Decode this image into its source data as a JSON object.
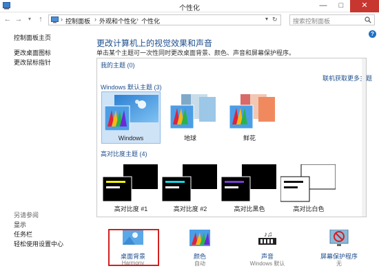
{
  "window": {
    "title": "个性化"
  },
  "window_buttons": {
    "minimize": "—",
    "maximize": "□",
    "close": "✕"
  },
  "navbar": {
    "breadcrumbs": [
      "控制面板",
      "外观和个性化",
      "个性化"
    ],
    "search_placeholder": "搜索控制面板"
  },
  "sidebar": {
    "links": [
      "控制面板主页",
      "更改桌面图标",
      "更改鼠标指针"
    ],
    "see_also_title": "另请参阅",
    "see_also": [
      "显示",
      "任务栏",
      "轻松使用设置中心"
    ]
  },
  "main": {
    "headline": "更改计算机上的视觉效果和声音",
    "subline": "单击某个主题可一次性同时更改桌面背景、颜色、声音和屏幕保护程序。",
    "my_themes_label": "我的主题 (0)",
    "get_more_link": "联机获取更多主题",
    "default_themes_label": "Windows 默认主题 (3)",
    "themes": [
      {
        "name": "Windows",
        "selected": true
      },
      {
        "name": "地球",
        "selected": false
      },
      {
        "name": "鲜花",
        "selected": false
      }
    ],
    "high_contrast_label": "高对比度主题 (4)",
    "high_contrast_themes": [
      {
        "name": "高对比度 #1",
        "bar": "#f5f500"
      },
      {
        "name": "高对比度 #2",
        "bar": "#12d8e8"
      },
      {
        "name": "高对比黑色",
        "bar": "#7a3bd6"
      },
      {
        "name": "高对比白色",
        "bar": "#111111"
      }
    ]
  },
  "bottom": [
    {
      "label": "桌面背景",
      "value": "Harmony",
      "icon": "desktop-background-icon"
    },
    {
      "label": "颜色",
      "value": "自动",
      "icon": "color-icon"
    },
    {
      "label": "声音",
      "value": "Windows 默认",
      "icon": "sound-icon"
    },
    {
      "label": "屏幕保护程序",
      "value": "无",
      "icon": "screensaver-icon"
    }
  ],
  "colors": {
    "accent": "#1e4e8c",
    "selection": "#cfe3f7",
    "highlight_box": "#d21f1f"
  }
}
